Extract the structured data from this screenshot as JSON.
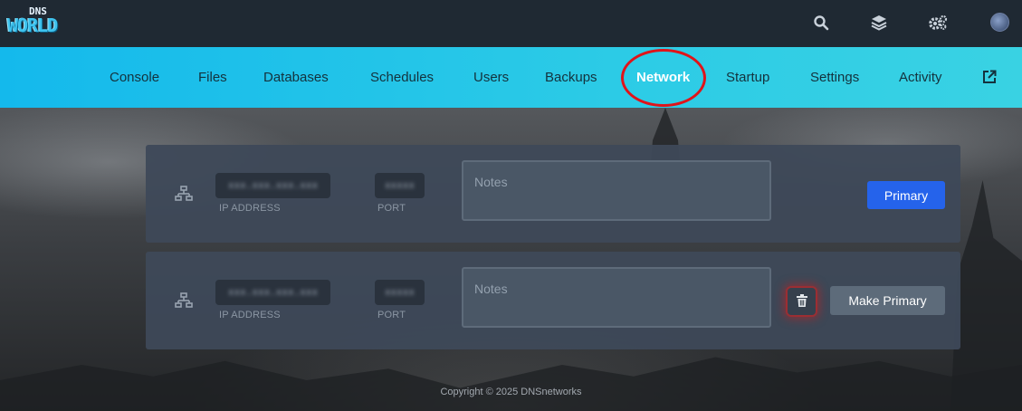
{
  "brand": {
    "logo_top": "DNS",
    "logo_main": "WORLD",
    "accent": "#3ec3ee"
  },
  "topbar": {
    "icons": [
      "search-icon",
      "layers-icon",
      "gears-icon",
      "avatar"
    ]
  },
  "nav": {
    "items": [
      {
        "label": "Console"
      },
      {
        "label": "Files"
      },
      {
        "label": "Databases"
      },
      {
        "label": "Schedules"
      },
      {
        "label": "Users"
      },
      {
        "label": "Backups"
      },
      {
        "label": "Network"
      },
      {
        "label": "Startup"
      },
      {
        "label": "Settings"
      },
      {
        "label": "Activity"
      }
    ],
    "active": "Network",
    "external_icon": "external-link-icon"
  },
  "allocations": [
    {
      "ip_address": "xxx.xxx.xxx.xxx",
      "port": "xxxxx",
      "ip_label": "IP ADDRESS",
      "port_label": "PORT",
      "notes_placeholder": "Notes",
      "action_label": "Primary",
      "is_primary": true
    },
    {
      "ip_address": "xxx.xxx.xxx.xxx",
      "port": "xxxxx",
      "ip_label": "IP ADDRESS",
      "port_label": "PORT",
      "notes_placeholder": "Notes",
      "action_label": "Make Primary",
      "is_primary": false
    }
  ],
  "footer": {
    "copyright": "Copyright © 2025 DNSnetworks"
  },
  "colors": {
    "navbar": "#14b9ec",
    "primary_button": "#2563eb",
    "card": "#3e4958",
    "highlight": "#e0141a"
  }
}
